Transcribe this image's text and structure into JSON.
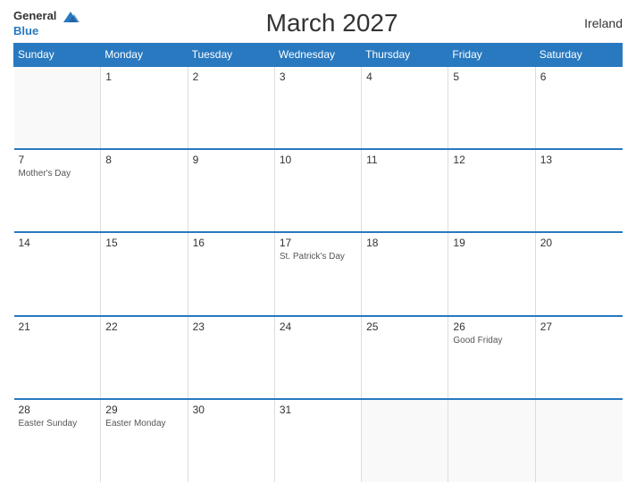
{
  "header": {
    "title": "March 2027",
    "country": "Ireland",
    "logo_general": "General",
    "logo_blue": "Blue"
  },
  "days_of_week": [
    "Sunday",
    "Monday",
    "Tuesday",
    "Wednesday",
    "Thursday",
    "Friday",
    "Saturday"
  ],
  "weeks": [
    [
      {
        "day": "",
        "event": "",
        "empty": true
      },
      {
        "day": "1",
        "event": ""
      },
      {
        "day": "2",
        "event": ""
      },
      {
        "day": "3",
        "event": ""
      },
      {
        "day": "4",
        "event": ""
      },
      {
        "day": "5",
        "event": ""
      },
      {
        "day": "6",
        "event": ""
      }
    ],
    [
      {
        "day": "7",
        "event": "Mother's Day"
      },
      {
        "day": "8",
        "event": ""
      },
      {
        "day": "9",
        "event": ""
      },
      {
        "day": "10",
        "event": ""
      },
      {
        "day": "11",
        "event": ""
      },
      {
        "day": "12",
        "event": ""
      },
      {
        "day": "13",
        "event": ""
      }
    ],
    [
      {
        "day": "14",
        "event": ""
      },
      {
        "day": "15",
        "event": ""
      },
      {
        "day": "16",
        "event": ""
      },
      {
        "day": "17",
        "event": "St. Patrick's Day"
      },
      {
        "day": "18",
        "event": ""
      },
      {
        "day": "19",
        "event": ""
      },
      {
        "day": "20",
        "event": ""
      }
    ],
    [
      {
        "day": "21",
        "event": ""
      },
      {
        "day": "22",
        "event": ""
      },
      {
        "day": "23",
        "event": ""
      },
      {
        "day": "24",
        "event": ""
      },
      {
        "day": "25",
        "event": ""
      },
      {
        "day": "26",
        "event": "Good Friday"
      },
      {
        "day": "27",
        "event": ""
      }
    ],
    [
      {
        "day": "28",
        "event": "Easter Sunday"
      },
      {
        "day": "29",
        "event": "Easter Monday"
      },
      {
        "day": "30",
        "event": ""
      },
      {
        "day": "31",
        "event": ""
      },
      {
        "day": "",
        "event": "",
        "empty": true
      },
      {
        "day": "",
        "event": "",
        "empty": true
      },
      {
        "day": "",
        "event": "",
        "empty": true
      }
    ]
  ],
  "colors": {
    "header_bg": "#2879c0",
    "accent": "#2879c0"
  }
}
